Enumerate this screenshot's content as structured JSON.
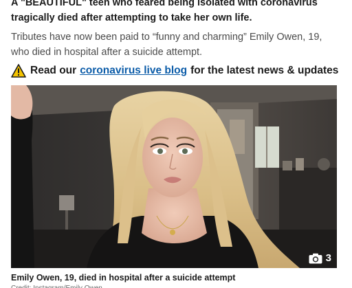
{
  "article": {
    "lede": "A \"BEAUTIFUL\" teen who feared being isolated with coronavirus tragically died after attempting to take her own life.",
    "tributes": "Tributes have now been paid to “funny and charming” Emily Owen, 19, who died in hospital after a suicide attempt.",
    "promo": {
      "icon": "warning-icon",
      "prefix": "Read our",
      "link_text": "coronavirus live blog",
      "suffix": "for the latest news & updates",
      "link_color": "#0a5ba8"
    },
    "photo": {
      "gallery_icon": "camera-icon",
      "gallery_count": "3"
    },
    "caption": "Emily Owen, 19, died in hospital after a suicide attempt",
    "credit": "Credit: Instagram/Emily Owen"
  }
}
